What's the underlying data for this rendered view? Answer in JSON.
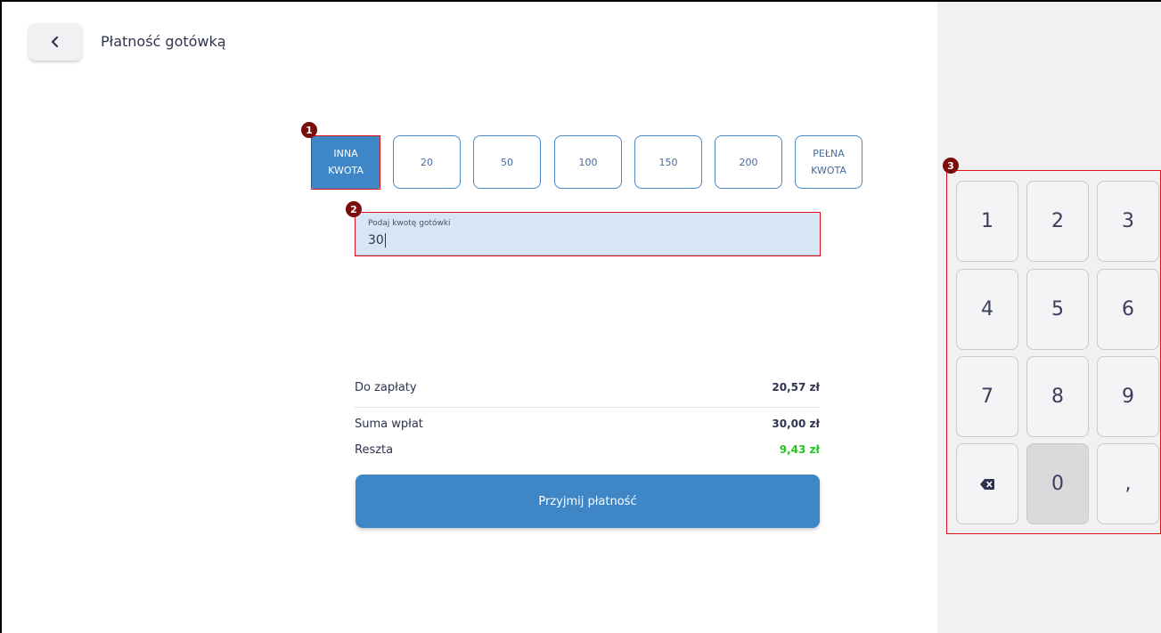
{
  "header": {
    "back_icon": "chevron-left-icon",
    "title": "Płatność gotówką"
  },
  "chips": [
    {
      "label_line1": "INNA",
      "label_line2": "KWOTA",
      "active": true
    },
    {
      "label_line1": "20",
      "label_line2": ""
    },
    {
      "label_line1": "50",
      "label_line2": ""
    },
    {
      "label_line1": "100",
      "label_line2": ""
    },
    {
      "label_line1": "150",
      "label_line2": ""
    },
    {
      "label_line1": "200",
      "label_line2": ""
    },
    {
      "label_line1": "PEŁNA",
      "label_line2": "KWOTA"
    }
  ],
  "cash_input": {
    "label": "Podaj kwotę gotówki",
    "value": "30"
  },
  "summary": {
    "due_label": "Do zapłaty",
    "due_value": "20,57 zł",
    "paid_label": "Suma wpłat",
    "paid_value": "30,00 zł",
    "change_label": "Reszta",
    "change_value": "9,43 zł"
  },
  "pay_button": {
    "label": "Przyjmij płatność"
  },
  "keypad": {
    "keys": [
      "1",
      "2",
      "3",
      "4",
      "5",
      "6",
      "7",
      "8",
      "9",
      "",
      "0",
      ","
    ],
    "backspace_icon": "backspace-icon",
    "pressed_key": "0"
  },
  "annotations": {
    "marker_1": "1",
    "marker_2": "2",
    "marker_3": "3"
  },
  "colors": {
    "accent": "#3f86c6",
    "highlight": "#e0101a",
    "marker": "#7a0c0c",
    "change": "#22c422",
    "input_bg": "#d7e6f4"
  }
}
